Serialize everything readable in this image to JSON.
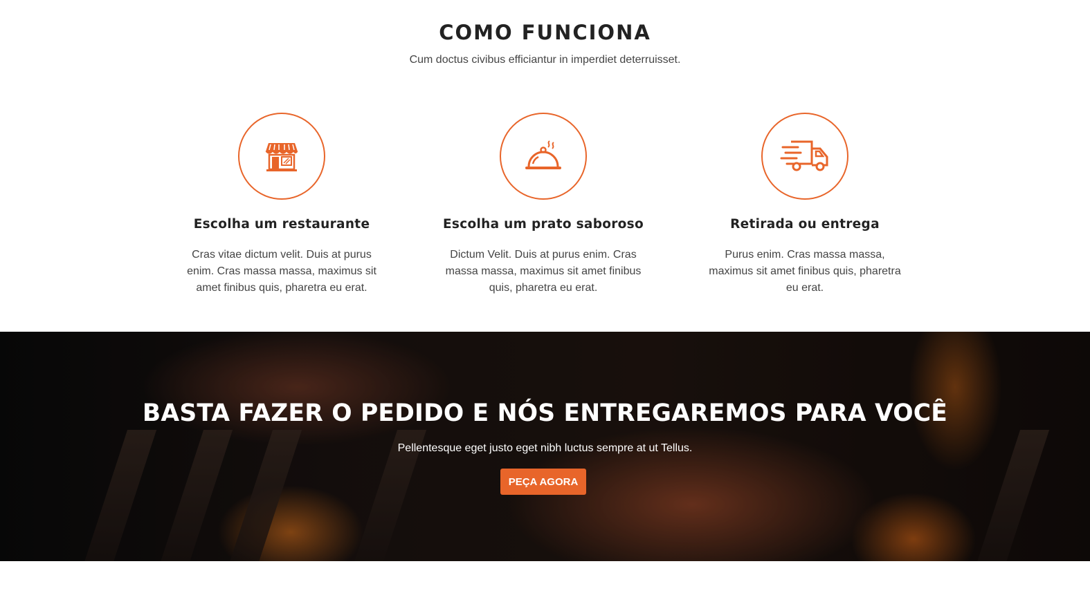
{
  "section": {
    "title": "COMO FUNCIONA",
    "subtitle": "Cum doctus civibus efficiantur in imperdiet deterruisset."
  },
  "steps": [
    {
      "icon": "restaurant-store-icon",
      "title": "Escolha um restaurante",
      "description": "Cras vitae dictum velit. Duis at purus enim. Cras massa massa, maximus sit amet finibus quis, pharetra eu erat."
    },
    {
      "icon": "food-cloche-icon",
      "title": "Escolha um prato saboroso",
      "description": "Dictum Velit. Duis at purus enim. Cras massa massa, maximus sit amet finibus quis, pharetra eu erat."
    },
    {
      "icon": "delivery-truck-icon",
      "title": "Retirada ou entrega",
      "description": "Purus enim. Cras massa massa, maximus sit amet finibus quis, pharetra eu erat."
    }
  ],
  "banner": {
    "title": "BASTA FAZER O PEDIDO E NÓS ENTREGAREMOS PARA VOCÊ",
    "subtitle": "Pellentesque eget justo eget nibh luctus sempre at ut Tellus.",
    "button_label": "PEÇA AGORA"
  },
  "colors": {
    "accent": "#e8652a",
    "heading": "#222222",
    "text": "#444444"
  }
}
